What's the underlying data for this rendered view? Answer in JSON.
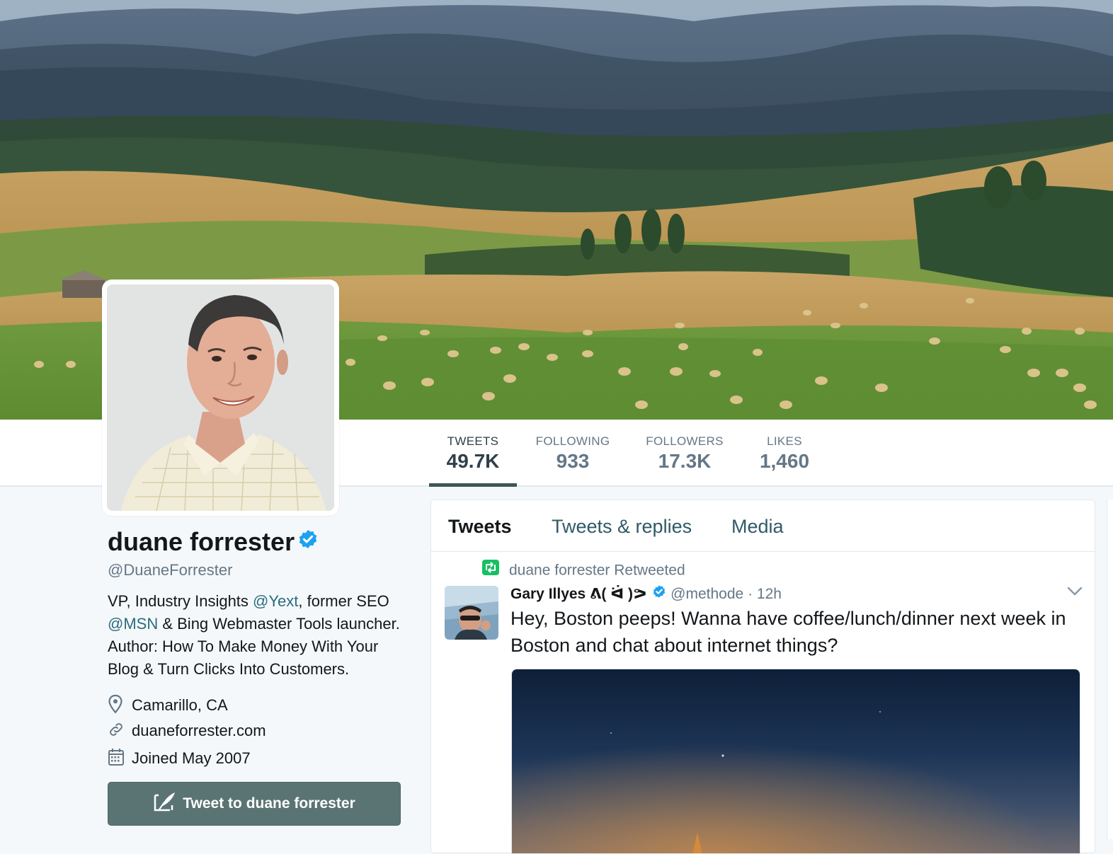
{
  "profile": {
    "name": "duane forrester",
    "handle": "@DuaneForrester",
    "bio": {
      "p1": "VP, Industry Insights ",
      "link1": "@Yext",
      "p2": ", former SEO ",
      "link2": "@MSN",
      "p3": " & Bing Webmaster Tools launcher. Author: How To Make Money With Your Blog & Turn Clicks Into Customers."
    },
    "location": "Camarillo, CA",
    "website": "duaneforrester.com",
    "joined": "Joined May 2007",
    "tweet_to_label": "Tweet to duane forrester"
  },
  "stats": [
    {
      "label": "TWEETS",
      "value": "49.7K"
    },
    {
      "label": "FOLLOWING",
      "value": "933"
    },
    {
      "label": "FOLLOWERS",
      "value": "17.3K"
    },
    {
      "label": "LIKES",
      "value": "1,460"
    }
  ],
  "timeline": {
    "tabs": [
      "Tweets",
      "Tweets & replies",
      "Media"
    ],
    "retweet_label": "duane forrester Retweeted",
    "tweet": {
      "author": "Gary Illyes ᕕ( ᐛ )ᕗ",
      "handle": "@methode",
      "time": "· 12h",
      "text": "Hey, Boston peeps! Wanna have coffee/lunch/dinner next week in Boston and chat about internet things?"
    }
  },
  "colors": {
    "theme": "#3f5656",
    "verified": "#1da1f2",
    "retweet": "#17bf63",
    "link": "#2a6c7e"
  }
}
